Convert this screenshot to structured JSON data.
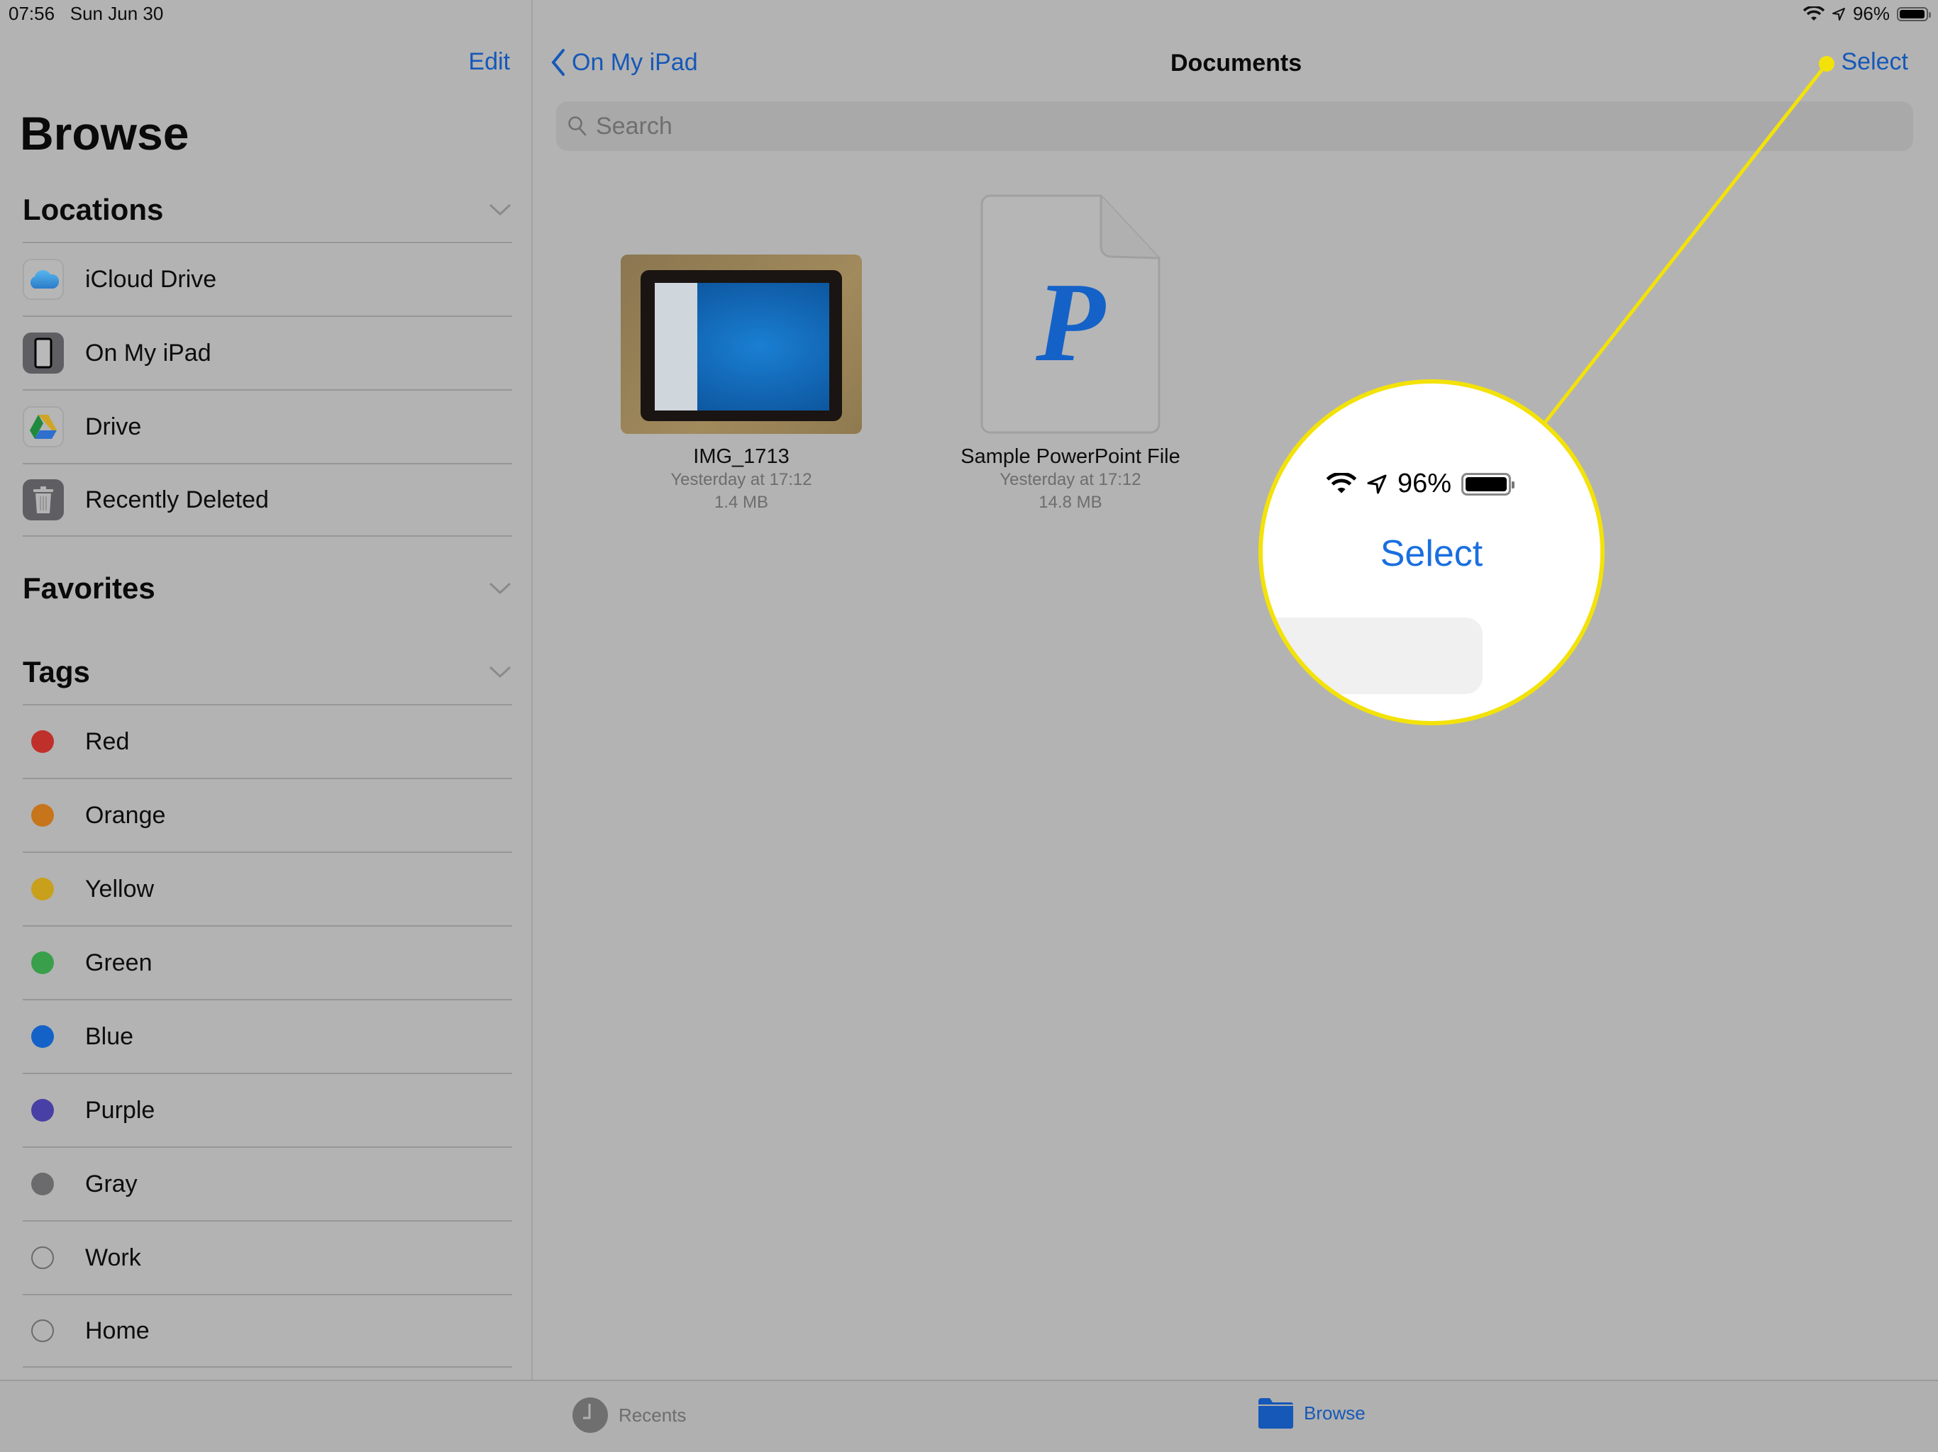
{
  "status_bar": {
    "time": "07:56",
    "date": "Sun Jun 30",
    "battery_percent_label": "96%",
    "battery_level": 0.96,
    "icons": [
      "wifi-icon",
      "location-arrow-icon",
      "battery-icon"
    ]
  },
  "sidebar": {
    "edit_label": "Edit",
    "title": "Browse",
    "locations": {
      "header": "Locations",
      "items": [
        {
          "label": "iCloud Drive",
          "icon": "icloud-icon"
        },
        {
          "label": "On My iPad",
          "icon": "ipad-icon"
        },
        {
          "label": "Drive",
          "icon": "google-drive-icon"
        },
        {
          "label": "Recently Deleted",
          "icon": "trash-icon"
        }
      ]
    },
    "favorites": {
      "header": "Favorites"
    },
    "tags": {
      "header": "Tags",
      "items": [
        {
          "label": "Red",
          "color": "#c0302b"
        },
        {
          "label": "Orange",
          "color": "#c7751b"
        },
        {
          "label": "Yellow",
          "color": "#c9a01c"
        },
        {
          "label": "Green",
          "color": "#3a9f4b"
        },
        {
          "label": "Blue",
          "color": "#1462c8"
        },
        {
          "label": "Purple",
          "color": "#4840a4"
        },
        {
          "label": "Gray",
          "color": "#6b6b6e"
        },
        {
          "label": "Work",
          "color": ""
        },
        {
          "label": "Home",
          "color": ""
        }
      ]
    }
  },
  "main": {
    "back_label": "On My iPad",
    "title": "Documents",
    "select_label": "Select",
    "search": {
      "placeholder": "Search",
      "value": ""
    },
    "files": [
      {
        "name": "IMG_1713",
        "modified": "Yesterday at 17:12",
        "size": "1.4 MB",
        "type": "image"
      },
      {
        "name": "Sample PowerPoint File",
        "modified": "Yesterday at 17:12",
        "size": "14.8 MB",
        "type": "powerpoint",
        "glyph": "P"
      }
    ]
  },
  "tab_bar": {
    "tabs": [
      {
        "label": "Recents",
        "icon": "clock-icon",
        "active": false
      },
      {
        "label": "Browse",
        "icon": "folder-icon",
        "active": true
      }
    ]
  },
  "annotation": {
    "magnified_battery_label": "96%",
    "magnified_select_label": "Select",
    "highlight_color": "#f3e20a"
  },
  "colors": {
    "accent": "#1558b8",
    "background": "#b3b3b3"
  }
}
